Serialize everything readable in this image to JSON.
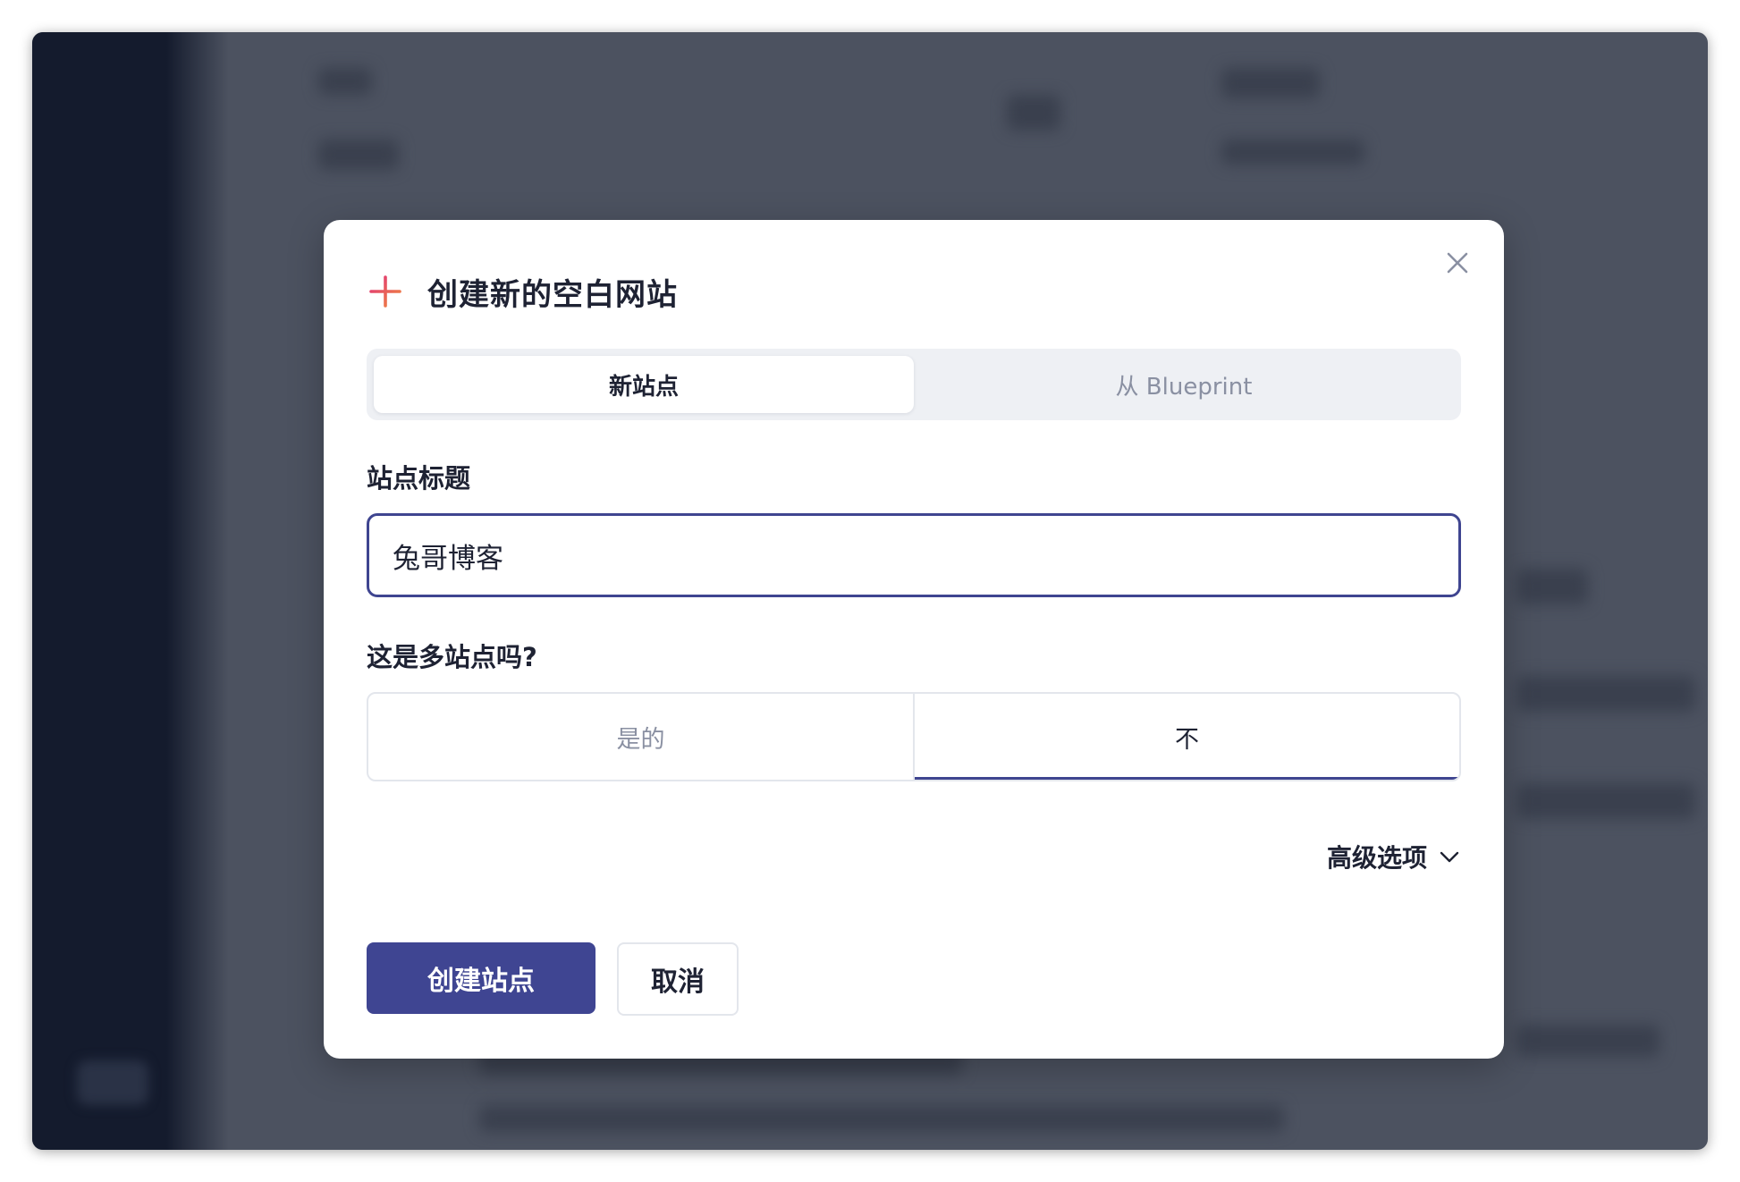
{
  "dialog": {
    "title": "创建新的空白网站",
    "tabs": [
      {
        "label": "新站点",
        "active": true
      },
      {
        "label": "从 Blueprint",
        "active": false
      }
    ],
    "site_title_label": "站点标题",
    "site_title_value": "兔哥博客",
    "multisite_label": "这是多站点吗?",
    "multisite_options": [
      {
        "label": "是的",
        "selected": false
      },
      {
        "label": "不",
        "selected": true
      }
    ],
    "advanced_label": "高级选项",
    "create_button": "创建站点",
    "cancel_button": "取消"
  },
  "icons": {
    "header": "plus-icon",
    "close": "close-icon",
    "advanced": "chevron-down-icon"
  },
  "colors": {
    "primary": "#3f4592",
    "plus_gradient_start": "#e0317a",
    "plus_gradient_end": "#f08a3c",
    "text": "#1e2233",
    "muted": "#8a90a2"
  }
}
